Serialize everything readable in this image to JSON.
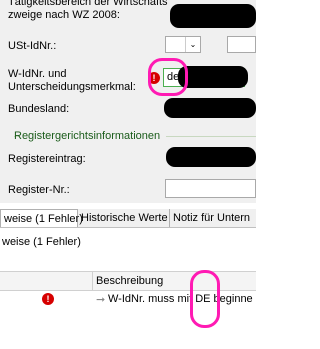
{
  "form": {
    "wz_label_partial": "zweige nach WZ 2008:",
    "ustid_label": "USt-IdNr.:",
    "widnr_label_line1": "W-IdNr. und",
    "widnr_label_line2": "Unterscheidungsmerkmal:",
    "widnr_value": "de",
    "bundesland_label": "Bundesland:",
    "group_title": "Registergerichtsinformationen",
    "registereintrag_label": "Registereintrag:",
    "register_nr_label": "Register-Nr.:"
  },
  "tabs": [
    {
      "label": "weise (1 Fehler)"
    },
    {
      "label": "Historische Werte"
    },
    {
      "label": "Notiz für Untern"
    }
  ],
  "errors_panel": {
    "subtitle": "weise (1 Fehler)",
    "column_description": "Beschreibung",
    "rows": [
      {
        "message": "W-IdNr. muss mit DE beginne"
      }
    ]
  },
  "colors": {
    "panel_bg": "#f0f0f0",
    "error_red": "#d60000",
    "highlight_pink": "#ff1ab3",
    "group_line_green": "#c8d8c0"
  }
}
